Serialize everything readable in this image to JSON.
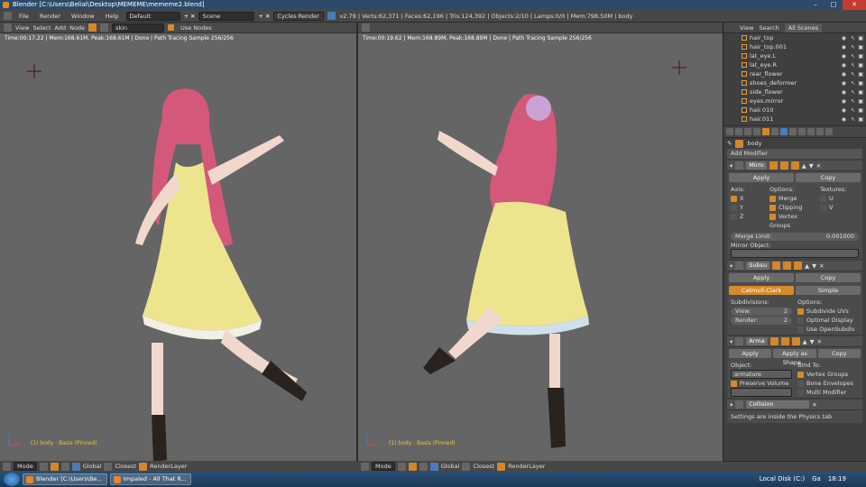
{
  "window": {
    "title": "Blender [C:\\Users\\Belial\\Desktop\\MEMEME\\mememe2.blend]"
  },
  "menus": [
    "File",
    "Render",
    "Window",
    "Help"
  ],
  "layout": "Default",
  "scene": "Scene",
  "engine": "Cycles Render",
  "info": "v2.79 | Verts:62,371 | Faces:62,196 | Tris:124,392 | Objects:2/10 | Lamps:0/0 | Mem:798.50M | body",
  "node_header": {
    "menus": [
      "View",
      "Select",
      "Add",
      "Node"
    ],
    "material": "skin",
    "use_nodes": "Use Nodes"
  },
  "vp1": {
    "stat": "Time:00:17.22 | Mem:168.61M, Peak:168.61M | Done | Path Tracing Sample 256/256",
    "label": "(1) body : Basis (Pinned)"
  },
  "vp2": {
    "stat": "Time:00:19.62 | Mem:168.89M, Peak:168.89M | Done | Path Tracing Sample 256/256",
    "label": "(1) body : Basis (Pinned)"
  },
  "vpfoot": {
    "mode": "Mode",
    "orient": "Global",
    "pivot": "Closest",
    "layer": "RenderLayer"
  },
  "outliner": {
    "tabs": [
      "View",
      "Search",
      "All Scenes"
    ],
    "items": [
      "hair_top",
      "hair_top.001",
      "lat_eye.L",
      "lat_eye.R",
      "rear_flower",
      "shoes_deformer",
      "side_flower",
      "eyes.mirror",
      "hair.010",
      "hair.011"
    ]
  },
  "props": {
    "object": "body",
    "add_modifier": "Add Modifier",
    "mirror": {
      "name": "Mirro",
      "apply": "Apply",
      "copy": "Copy",
      "axis": "Axis:",
      "options": "Options:",
      "textures": "Textures:",
      "x": "X",
      "y": "Y",
      "z": "Z",
      "merge": "Merge",
      "clipping": "Clipping",
      "vgroups": "Vertex Groups",
      "u": "U",
      "v": "V",
      "merge_limit": "Merge Limit:",
      "merge_val": "0.001000",
      "mirror_obj": "Mirror Object:"
    },
    "subsurf": {
      "name": "Subsu",
      "apply": "Apply",
      "copy": "Copy",
      "cc": "Catmull-Clark",
      "simple": "Simple",
      "subdiv": "Subdivisions:",
      "options": "Options:",
      "view": "View:",
      "view_v": "2",
      "render": "Render:",
      "render_v": "2",
      "uvs": "Subdivide UVs",
      "optimal": "Optimal Display",
      "opensubdiv": "Use OpenSubdiv"
    },
    "armature": {
      "name": "Arma",
      "apply": "Apply",
      "apply_shape": "Apply as Shape...",
      "copy": "Copy",
      "object": "Object:",
      "obj_v": "armature",
      "bind": "Bind To:",
      "vgroups": "Vertex Groups",
      "envelopes": "Bone Envelopes",
      "preserve": "Preserve Volume",
      "multi": "Multi Modifier"
    },
    "collision": {
      "name": "Collision",
      "note": "Settings are inside the Physics tab"
    }
  },
  "taskbar": {
    "items": [
      "Blender [C:\\Users\\Be...",
      "Impaled - All That R..."
    ],
    "disk": "Local Disk (C:)",
    "ga": "Ga",
    "time": "18:19"
  }
}
